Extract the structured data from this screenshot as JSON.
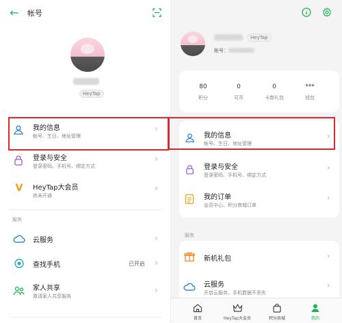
{
  "left": {
    "title": "帐号",
    "badge": "HeyTap",
    "rows": [
      {
        "label": "我的信息",
        "sub": "帐号、生日、地址管理"
      },
      {
        "label": "登录与安全",
        "sub": "登录密码、手机号、绑定方式"
      },
      {
        "label": "HeyTap大会员",
        "sub": "尚未开通"
      }
    ],
    "section": "服务",
    "service_rows": [
      {
        "label": "云服务",
        "sub": "",
        "value": ""
      },
      {
        "label": "查找手机",
        "sub": "",
        "value": "已开启"
      },
      {
        "label": "家人共享",
        "sub": "邀请家人共享服务",
        "value": ""
      }
    ]
  },
  "right": {
    "badge": "HeyTap",
    "account_label": "帐号：",
    "stats": [
      {
        "value": "80",
        "caption": "积分"
      },
      {
        "value": "0",
        "caption": "可币"
      },
      {
        "value": "0",
        "caption": "卡券礼包"
      },
      {
        "value": "***",
        "caption": "钱包"
      }
    ],
    "rows": [
      {
        "label": "我的信息",
        "sub": "帐号、生日、地址管理"
      },
      {
        "label": "登录与安全",
        "sub": "登录密码、手机号、绑定方式"
      },
      {
        "label": "我的订单",
        "sub": "会员中心、积分商城订单"
      }
    ],
    "section": "服务",
    "service_rows": [
      {
        "label": "新机礼包",
        "sub": ""
      },
      {
        "label": "云服务",
        "sub": "开启云服务，手机数据不丢失"
      }
    ],
    "tabs": [
      {
        "label": "首页"
      },
      {
        "label": "HeyTap大会员"
      },
      {
        "label": "积分商城"
      },
      {
        "label": "我的"
      }
    ]
  },
  "colors": {
    "accent": "#22b15a",
    "highlight": "#e0252b"
  }
}
